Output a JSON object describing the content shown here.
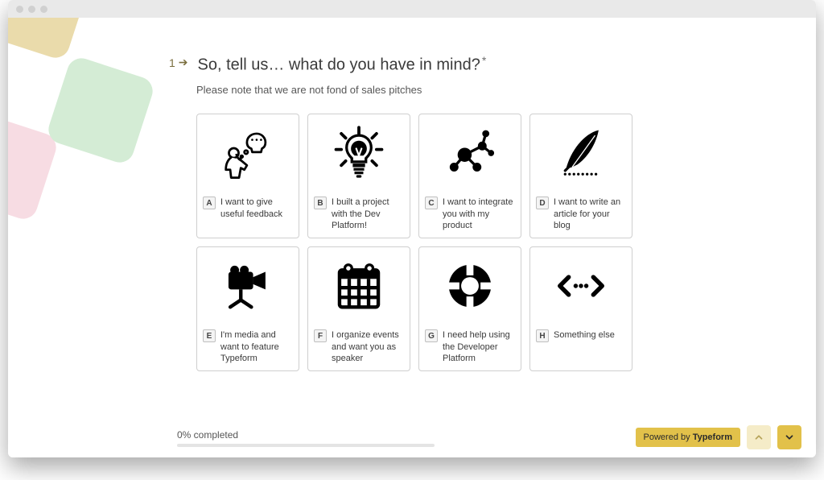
{
  "question": {
    "number": "1",
    "text": "So, tell us… what do you have in mind?",
    "required_mark": "*",
    "note": "Please note that we are not fond of sales pitches"
  },
  "options": [
    {
      "key": "A",
      "label": "I want to give useful feedback"
    },
    {
      "key": "B",
      "label": "I built a project with the Dev Platform!"
    },
    {
      "key": "C",
      "label": "I want to integrate you with my product"
    },
    {
      "key": "D",
      "label": "I want to write an article for your blog"
    },
    {
      "key": "E",
      "label": "I'm media and want to feature Typeform"
    },
    {
      "key": "F",
      "label": "I organize events and want you as speaker"
    },
    {
      "key": "G",
      "label": "I need help using the Developer Platform"
    },
    {
      "key": "H",
      "label": "Something else"
    }
  ],
  "footer": {
    "progress_text": "0% completed",
    "powered_prefix": "Powered by ",
    "powered_brand": "Typeform"
  }
}
